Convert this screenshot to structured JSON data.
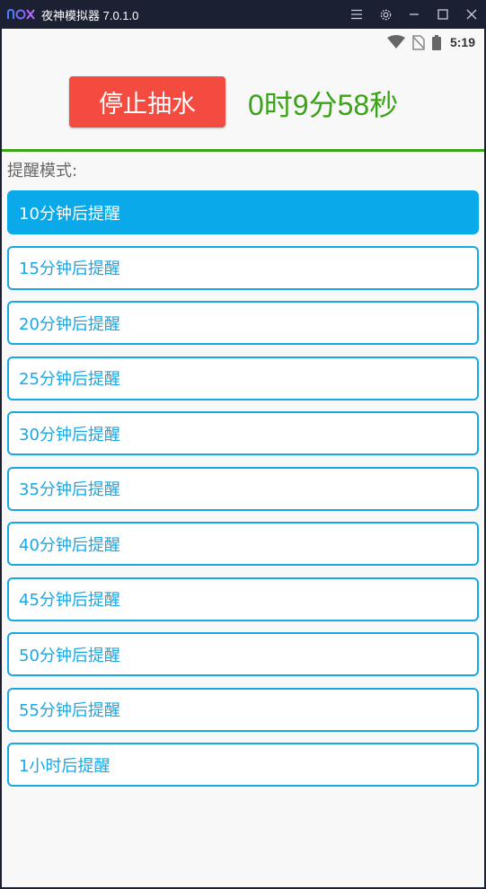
{
  "window": {
    "logo_text": "nox",
    "title": "夜神模拟器 7.0.1.0",
    "controls": [
      "menu-icon",
      "gear-icon",
      "minimize-icon",
      "maximize-icon",
      "close-icon"
    ]
  },
  "statusbar": {
    "icons": [
      "wifi-icon",
      "no-sim-icon",
      "battery-icon"
    ],
    "time": "5:19"
  },
  "main": {
    "stop_button_label": "停止抽水",
    "timer_text": "0时9分58秒",
    "mode_label": "提醒模式:",
    "options": [
      {
        "label": "10分钟后提醒",
        "selected": true
      },
      {
        "label": "15分钟后提醒",
        "selected": false
      },
      {
        "label": "20分钟后提醒",
        "selected": false
      },
      {
        "label": "25分钟后提醒",
        "selected": false
      },
      {
        "label": "30分钟后提醒",
        "selected": false
      },
      {
        "label": "35分钟后提醒",
        "selected": false
      },
      {
        "label": "40分钟后提醒",
        "selected": false
      },
      {
        "label": "45分钟后提醒",
        "selected": false
      },
      {
        "label": "50分钟后提醒",
        "selected": false
      },
      {
        "label": "55分钟后提醒",
        "selected": false
      },
      {
        "label": "1小时后提醒",
        "selected": false
      }
    ]
  },
  "colors": {
    "titlebar": "#1b2033",
    "stop_button": "#f44b40",
    "timer": "#3aa317",
    "accent": "#17a8e5",
    "selected": "#0aa9ea"
  }
}
